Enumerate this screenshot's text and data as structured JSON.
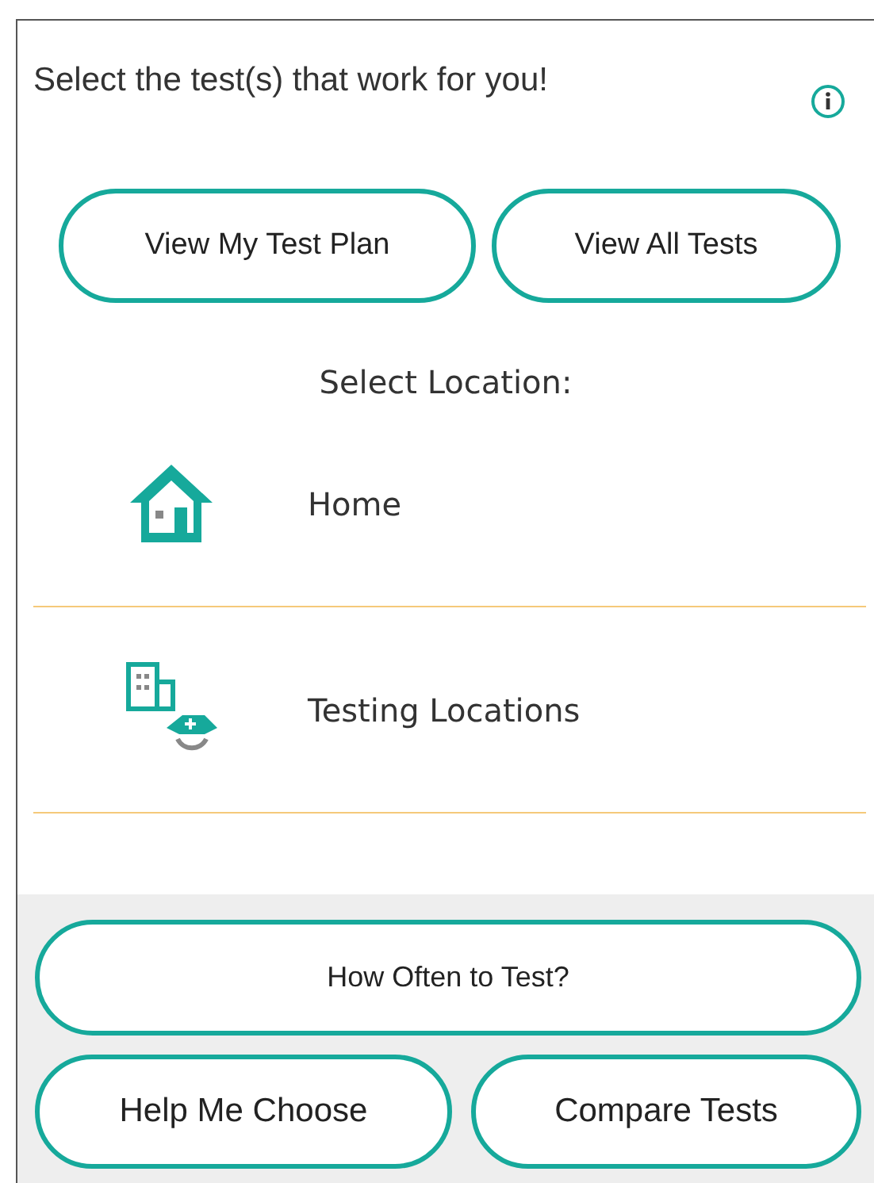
{
  "heading": "Select the test(s) that work for you!",
  "top_buttons": [
    "View My Test Plan",
    "View All Tests"
  ],
  "location_title": "Select Location:",
  "locations": [
    {
      "kind": "home",
      "label": "Home"
    },
    {
      "kind": "testing",
      "label": "Testing Locations"
    }
  ],
  "footer": {
    "wide_button": "How Often to Test?",
    "buttons": [
      "Help Me Choose",
      "Compare Tests"
    ]
  }
}
